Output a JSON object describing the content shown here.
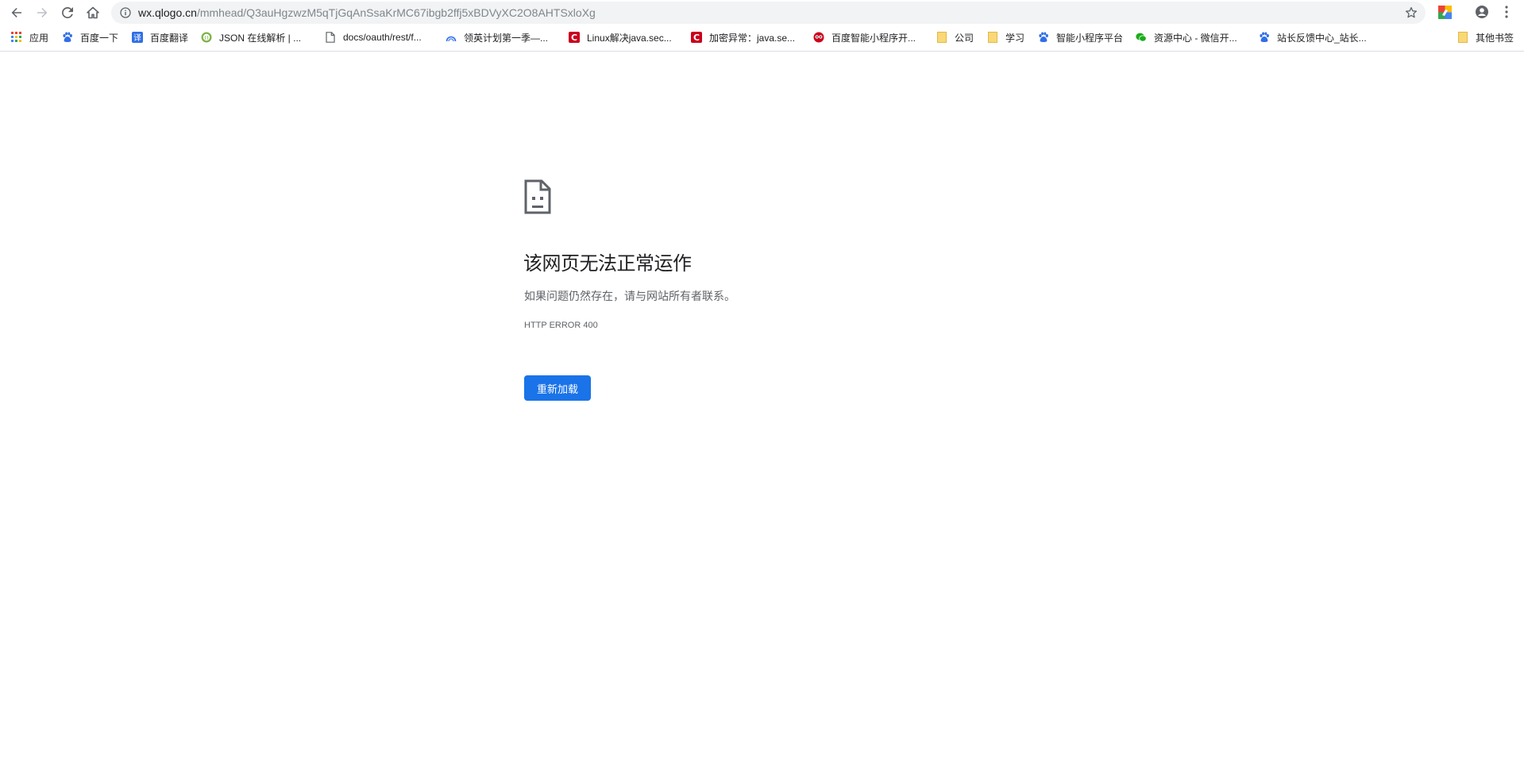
{
  "browser": {
    "url_host": "wx.qlogo.cn",
    "url_path": "/mmhead/Q3auHgzwzM5qTjGqAnSsaKrMC67ibgb2ffj5xBDVyXC2O8AHTSxloXg",
    "icons": {
      "back": "back-arrow-icon",
      "forward": "forward-arrow-icon",
      "reload": "reload-icon",
      "home": "home-icon",
      "info": "info-icon",
      "star": "star-icon",
      "extension": "extension-icon",
      "profile": "profile-icon",
      "menu": "menu-icon"
    }
  },
  "bookmarks": {
    "items": [
      {
        "label": "应用",
        "icon": "apps-grid-icon"
      },
      {
        "label": "百度一下",
        "icon": "baidu-paw-icon"
      },
      {
        "label": "百度翻译",
        "icon": "baidu-translate-icon"
      },
      {
        "label": "JSON 在线解析 | ...",
        "icon": "json-icon"
      },
      {
        "label": "docs/oauth/rest/f...",
        "icon": "page-icon"
      },
      {
        "label": "领英计划第一季—...",
        "icon": "rainbow-icon"
      },
      {
        "label": "Linux解决java.sec...",
        "icon": "csdn-icon"
      },
      {
        "label": "加密异常：java.se...",
        "icon": "csdn-icon"
      },
      {
        "label": "百度智能小程序开...",
        "icon": "owl-icon"
      },
      {
        "label": "公司",
        "icon": "folder-icon"
      },
      {
        "label": "学习",
        "icon": "folder-icon"
      },
      {
        "label": "智能小程序平台",
        "icon": "baidu-paw-icon"
      },
      {
        "label": "资源中心 - 微信开...",
        "icon": "wechat-icon"
      },
      {
        "label": "站长反馈中心_站长...",
        "icon": "baidu-paw-icon"
      }
    ],
    "other": {
      "label": "其他书签",
      "icon": "folder-icon"
    }
  },
  "error_page": {
    "icon": "sad-page-icon",
    "title": "该网页无法正常运作",
    "description": "如果问题仍然存在，请与网站所有者联系。",
    "code": "HTTP ERROR 400",
    "reload_label": "重新加载"
  },
  "colors": {
    "accent": "#1a73e8",
    "omnibox_bg": "#f1f3f4",
    "text_primary": "#202124",
    "text_secondary": "#5f6368",
    "folder": "#f9d877",
    "csdn_red": "#c9001d",
    "baidu_blue": "#2f6ee7",
    "wechat_green": "#1aad19"
  }
}
